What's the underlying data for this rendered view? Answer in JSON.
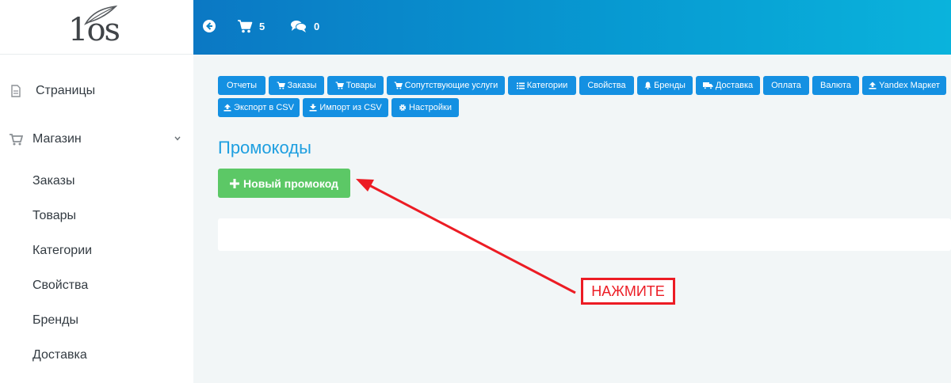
{
  "logo": {
    "text": "1os"
  },
  "header": {
    "cart_count": "5",
    "comments_count": "0"
  },
  "sidebar": {
    "pages_label": "Страницы",
    "shop_label": "Магазин",
    "shop_items": [
      {
        "label": "Заказы"
      },
      {
        "label": "Товары"
      },
      {
        "label": "Категории"
      },
      {
        "label": "Свойства"
      },
      {
        "label": "Бренды"
      },
      {
        "label": "Доставка"
      }
    ]
  },
  "toolbar": {
    "buttons": [
      {
        "label": "Отчеты",
        "icon": "none"
      },
      {
        "label": "Заказы",
        "icon": "cart-icon"
      },
      {
        "label": "Товары",
        "icon": "cart-icon"
      },
      {
        "label": "Сопутствующие услуги",
        "icon": "cart-icon"
      },
      {
        "label": "Категории",
        "icon": "list-icon"
      },
      {
        "label": "Свойства",
        "icon": "none"
      },
      {
        "label": "Бренды",
        "icon": "bell-icon"
      },
      {
        "label": "Доставка",
        "icon": "truck-icon"
      },
      {
        "label": "Оплата",
        "icon": "none"
      },
      {
        "label": "Валюта",
        "icon": "none"
      },
      {
        "label": "Yandex Маркет",
        "icon": "upload-icon"
      },
      {
        "label": "Экспорт в CSV",
        "icon": "upload-icon"
      },
      {
        "label": "Импорт из CSV",
        "icon": "download-icon"
      },
      {
        "label": "Настройки",
        "icon": "gear-icon"
      }
    ]
  },
  "main": {
    "title": "Промокоды",
    "new_button_label": "Новый промокод"
  },
  "annotation": {
    "text": "НАЖМИТЕ",
    "color": "#ec1c24"
  },
  "colors": {
    "header_start": "#0b78c4",
    "header_end": "#0ab3dc",
    "toolbar_button": "#1490e2",
    "primary_button": "#5cc866",
    "title": "#1e9fe0"
  }
}
